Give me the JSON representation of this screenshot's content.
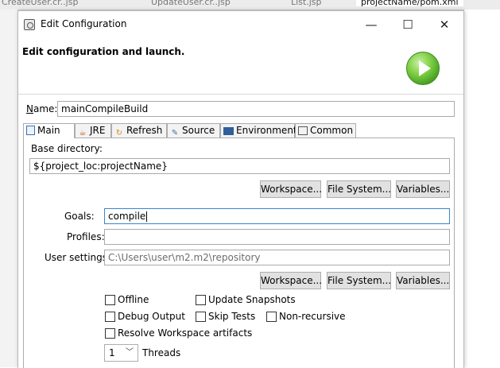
{
  "background_tabs": [
    "CreateUser.cr..jsp",
    "UpdateUser.cr..jsp",
    "List.jsp",
    "projectName/pom.xml"
  ],
  "dialog": {
    "title": "Edit Configuration",
    "heading": "Edit configuration and launch.",
    "controls": {
      "minimize": "—",
      "maximize": "☐",
      "close": "✕"
    }
  },
  "name": {
    "label": "Name:",
    "value": "mainCompileBuild"
  },
  "tabs": [
    {
      "label": "Main",
      "icon": "main-tab-icon",
      "active": true
    },
    {
      "label": "JRE",
      "icon": "jre-icon"
    },
    {
      "label": "Refresh",
      "icon": "refresh-icon"
    },
    {
      "label": "Source",
      "icon": "source-icon"
    },
    {
      "label": "Environment",
      "icon": "environment-icon"
    },
    {
      "label": "Common",
      "icon": "common-icon"
    }
  ],
  "main": {
    "base_directory": {
      "label": "Base directory:",
      "value": "${project_loc:projectName}"
    },
    "buttons_row1": {
      "workspace": "Workspace...",
      "filesystem": "File System...",
      "variables": "Variables..."
    },
    "goals": {
      "label": "Goals:",
      "value": "compile"
    },
    "profiles": {
      "label": "Profiles:",
      "value": ""
    },
    "user_settings": {
      "label": "User settings:",
      "value": "C:\\Users\\user\\m2.m2\\repository"
    },
    "buttons_row2": {
      "workspace": "Workspace...",
      "filesystem": "File System...",
      "variables": "Variables..."
    },
    "options": {
      "offline": "Offline",
      "update_snapshots": "Update Snapshots",
      "debug_output": "Debug Output",
      "skip_tests": "Skip Tests",
      "non_recursive": "Non-recursive",
      "resolve_workspace": "Resolve Workspace artifacts"
    },
    "threads": {
      "value": "1",
      "label": "Threads"
    }
  }
}
